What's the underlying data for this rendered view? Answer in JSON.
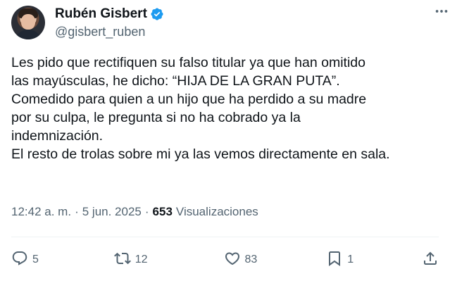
{
  "author": {
    "display_name": "Rubén Gisbert",
    "handle": "@gisbert_ruben",
    "verified": true
  },
  "tweet": {
    "lines": [
      "Les pido que rectifiquen su falso titular ya que han omitido",
      "las mayúsculas, he dicho: “HIJA DE LA GRAN PUTA”.",
      "Comedido para quien a un hijo que ha perdido a su madre",
      "por su culpa, le pregunta si no ha cobrado ya la",
      "indemnización.",
      "El resto de trolas sobre mi ya las vemos directamente en sala."
    ]
  },
  "meta": {
    "time": "12:42 a. m.",
    "separator": "·",
    "date": "5 jun. 2025",
    "views_count": "653",
    "views_label": "Visualizaciones"
  },
  "actions": {
    "replies": "5",
    "reposts": "12",
    "likes": "83",
    "bookmarks": "1"
  },
  "colors": {
    "text": "#0f1419",
    "secondary": "#536471",
    "verified": "#1d9bf0",
    "divider": "#eff3f4"
  },
  "icons": [
    "more-icon",
    "verified-icon",
    "reply-icon",
    "repost-icon",
    "like-icon",
    "bookmark-icon",
    "share-icon"
  ]
}
